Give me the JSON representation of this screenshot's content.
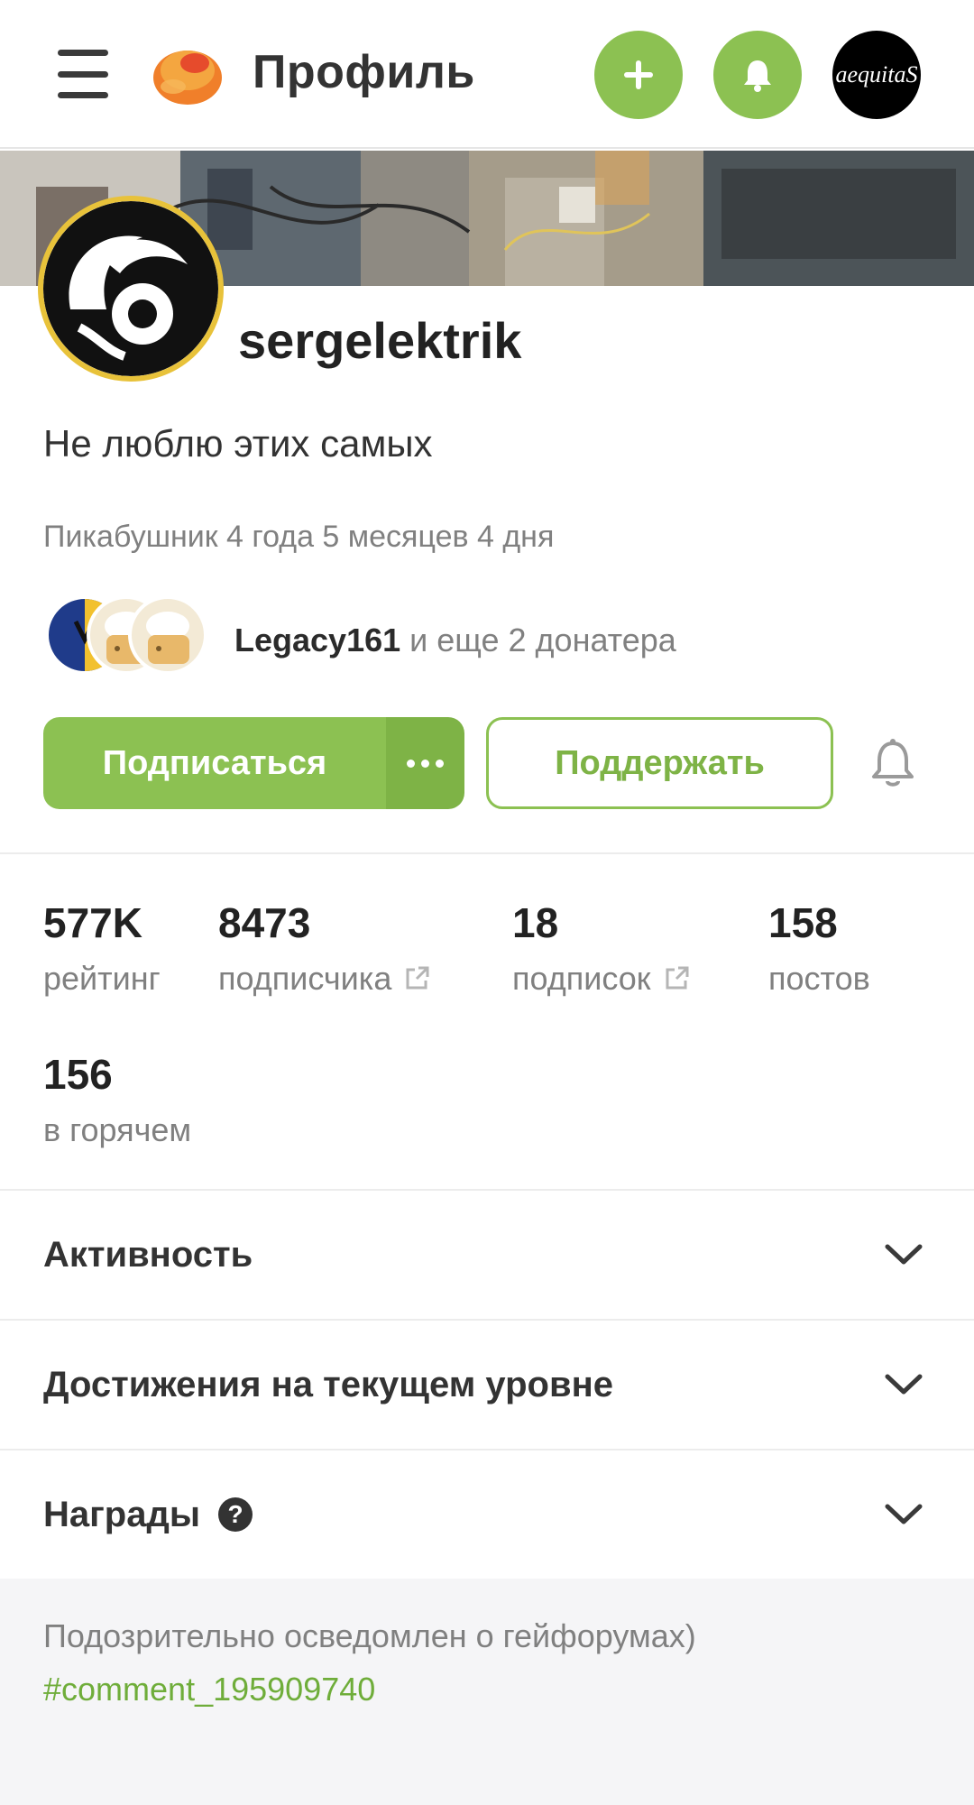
{
  "header": {
    "title": "Профиль",
    "menu_icon": "hamburger-menu-icon",
    "logo_icon": "pikabu-logo-icon",
    "add_icon": "plus-icon",
    "bell_icon": "bell-icon",
    "user_avatar_text": "aequitaS",
    "accent_color": "#8cc152"
  },
  "profile": {
    "username": "sergelektrik",
    "bio": "Не люблю этих самых",
    "membership": "Пикабушник 4 года 5 месяцев 4 дня",
    "avatar_border_color": "#e8c23a"
  },
  "donors": {
    "name": "Legacy161",
    "suffix": " и еще 2 донатера"
  },
  "actions": {
    "subscribe_label": "Подписаться",
    "support_label": "Поддержать",
    "more_icon": "more-dots-icon",
    "notify_icon": "bell-outline-icon"
  },
  "stats": [
    {
      "value": "577K",
      "label": "рейтинг"
    },
    {
      "value": "8473",
      "label": "подписчика"
    },
    {
      "value": "18",
      "label": "подписок"
    },
    {
      "value": "158",
      "label": "постов"
    },
    {
      "value": "156",
      "label": "в горячем"
    }
  ],
  "sections": [
    {
      "label": "Активность"
    },
    {
      "label": "Достижения на текущем уровне"
    },
    {
      "label": "Награды"
    }
  ],
  "award": {
    "text": "Подозрительно осведомлен о гейфорумах)",
    "link": "#comment_195909740",
    "link_color": "#6fad3a"
  }
}
